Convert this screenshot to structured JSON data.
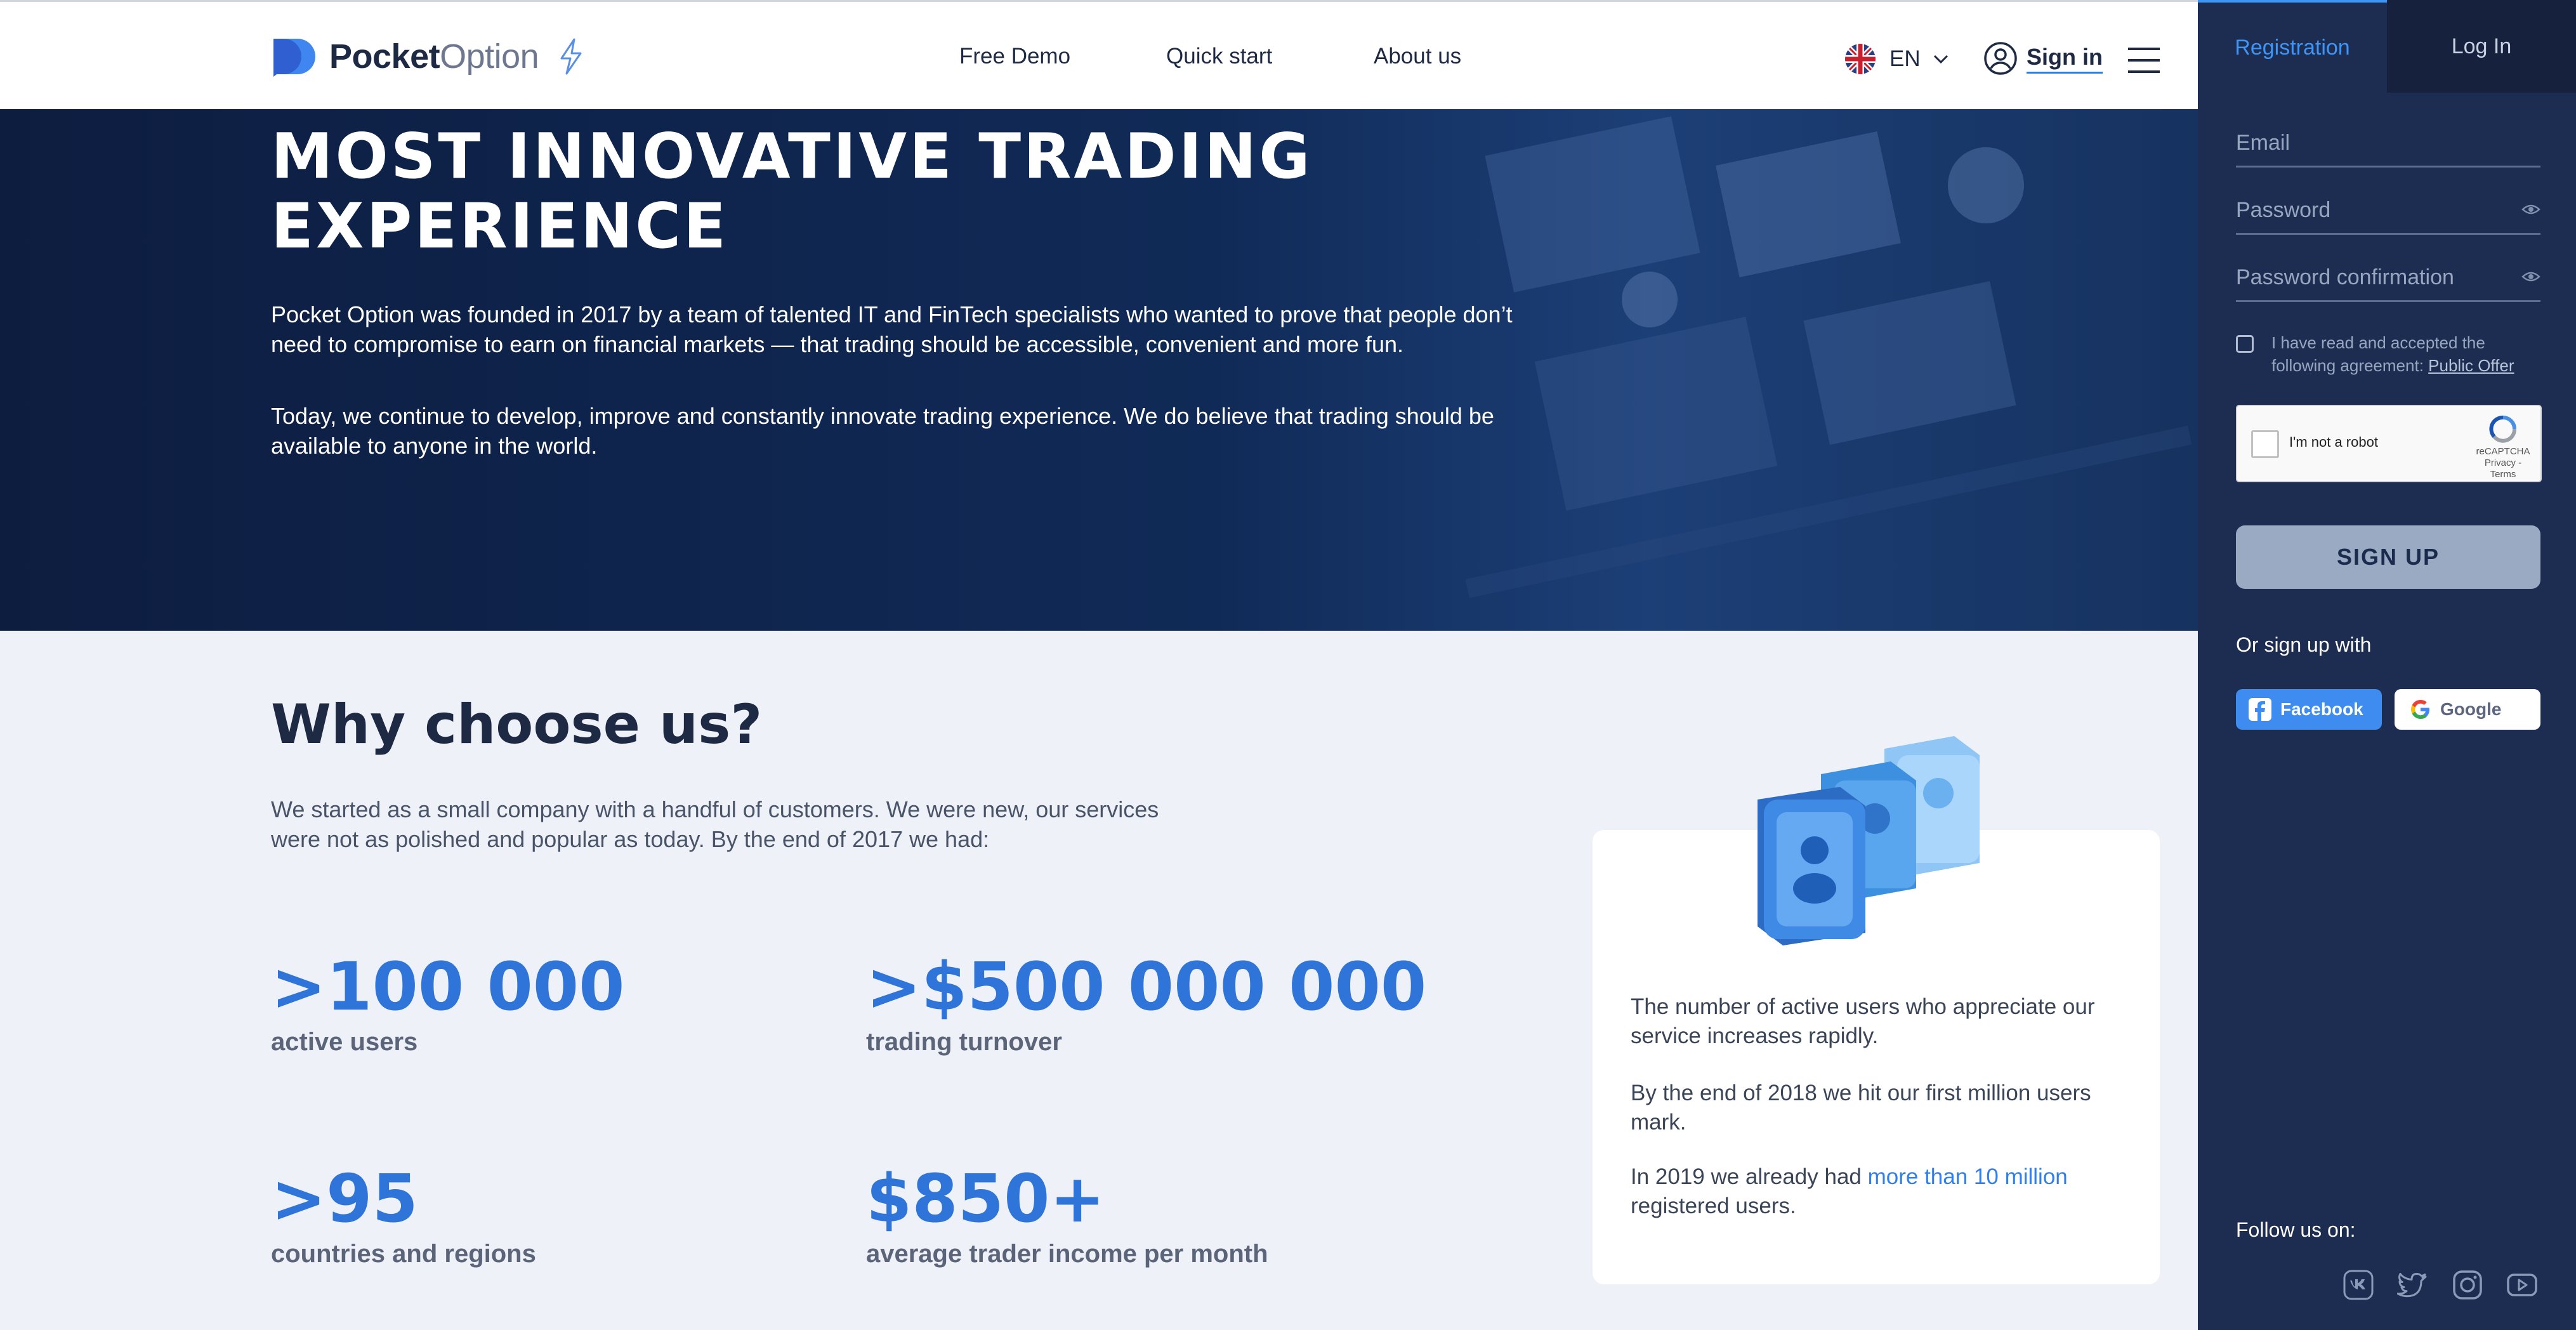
{
  "header": {
    "logo": {
      "bold": "Pocket",
      "light": "Option"
    },
    "nav": [
      "Free Demo",
      "Quick start",
      "About us"
    ],
    "lang": "EN",
    "sign_in": "Sign in"
  },
  "hero": {
    "title": "MOST INNOVATIVE TRADING EXPERIENCE",
    "p1": "Pocket Option was founded in 2017 by a team of talented IT and FinTech specialists who wanted to prove that people don’t need to compromise to earn on financial markets — that trading should be accessible, convenient and more fun.",
    "p2": "Today, we continue to develop, improve and constantly innovate trading experience. We do believe that trading should be available to anyone in the world."
  },
  "why": {
    "title": "Why choose us?",
    "intro": "We started as a small company with a handful of customers. We were new, our services were not as polished and popular as today. By the end of 2017 we had:",
    "stats": [
      {
        "value": ">100 000",
        "label": "active users"
      },
      {
        "value": ">$500 000 000",
        "label": "trading turnover"
      },
      {
        "value": ">95",
        "label": "countries and regions"
      },
      {
        "value": "$850+",
        "label": "average trader income per month"
      }
    ],
    "card": {
      "p1": "The number of active users who appreciate our service increases rapidly.",
      "p2": "By the end of 2018 we hit our first million users mark.",
      "p3_prefix": "In 2019 we already had ",
      "p3_highlight": "more than 10 million",
      "p3_suffix": "registered users."
    }
  },
  "sidebar": {
    "tabs": [
      "Registration",
      "Log In"
    ],
    "email_placeholder": "Email",
    "password_placeholder": "Password",
    "password_confirm_placeholder": "Password confirmation",
    "agree_text": "I have read and accepted the following agreement:",
    "agree_link": "Public Offer",
    "captcha_label": "I'm not a robot",
    "captcha_brand": "reCAPTCHA",
    "captcha_links": "Privacy - Terms",
    "signup_button": "SIGN UP",
    "or_sign_up_with": "Or sign up with",
    "facebook": "Facebook",
    "google": "Google",
    "follow": "Follow us on:",
    "social_icons": [
      "vk-icon",
      "twitter-icon",
      "instagram-icon",
      "youtube-icon"
    ]
  },
  "colors": {
    "accent": "#2f74d8",
    "hero_bg": "#0d1d40",
    "sidebar_bg": "#1d2d52",
    "tab_active": "#3e95f5"
  }
}
